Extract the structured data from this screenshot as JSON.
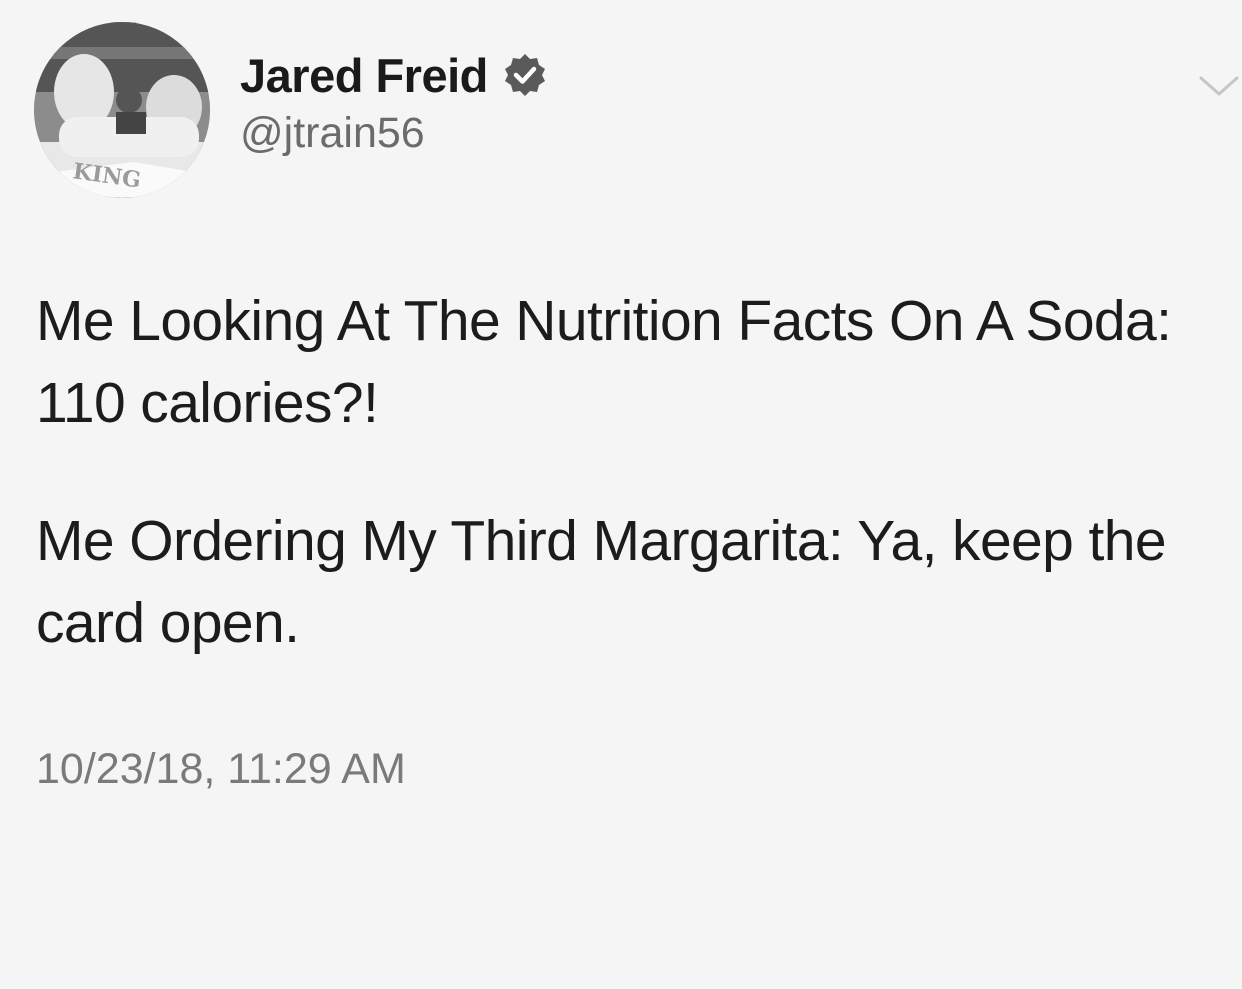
{
  "author": {
    "display_name": "Jared Freid",
    "handle": "@jtrain56",
    "verified": true,
    "avatar_logo_text": "KING"
  },
  "tweet": {
    "paragraphs": [
      "Me Looking At The Nutrition Facts On A Soda: 110 calories?!",
      "Me Ordering My Third Margarita: Ya, keep the card open."
    ],
    "timestamp": "10/23/18, 11:29 AM"
  },
  "icons": {
    "verified": "verified-badge-icon",
    "menu": "chevron-down-icon"
  },
  "colors": {
    "background": "#f5f5f5",
    "text": "#1c1c1c",
    "muted": "#7a7a7a"
  }
}
